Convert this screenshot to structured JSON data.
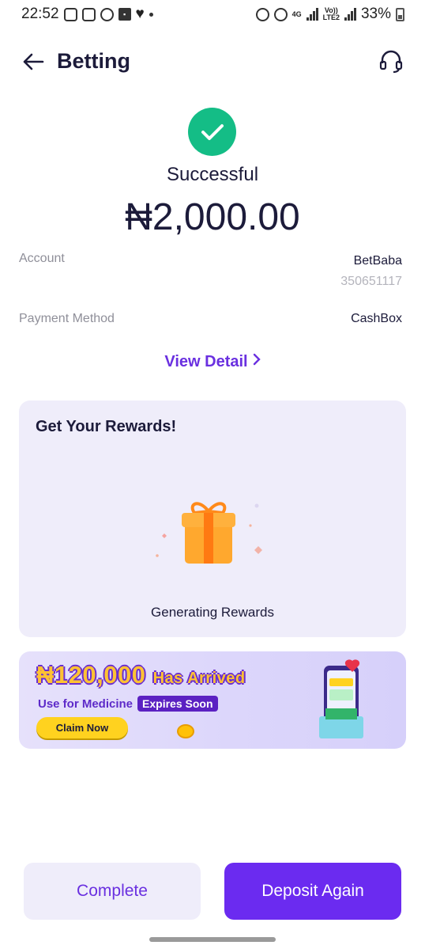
{
  "status_bar": {
    "time": "22:52",
    "network": "4G",
    "lte": "LTE2",
    "volte": "Vo))",
    "battery": "33%"
  },
  "header": {
    "title": "Betting"
  },
  "result": {
    "status": "Successful",
    "amount": "₦2,000.00"
  },
  "details": {
    "account_label": "Account",
    "account_name": "BetBaba",
    "account_number": "350651117",
    "payment_label": "Payment Method",
    "payment_value": "CashBox"
  },
  "view_detail": "View Detail",
  "rewards": {
    "title": "Get Your Rewards!",
    "status": "Generating Rewards"
  },
  "banner": {
    "amount": "₦120,000",
    "headline_suffix": "Has Arrived",
    "subtitle": "Use for Medicine",
    "tag": "Expires Soon",
    "cta": "Claim Now"
  },
  "buttons": {
    "complete": "Complete",
    "deposit_again": "Deposit Again"
  },
  "colors": {
    "accent": "#6b2bf0",
    "success": "#14bd86",
    "card_bg": "#efedfa",
    "gift": "#ff9a1f"
  }
}
